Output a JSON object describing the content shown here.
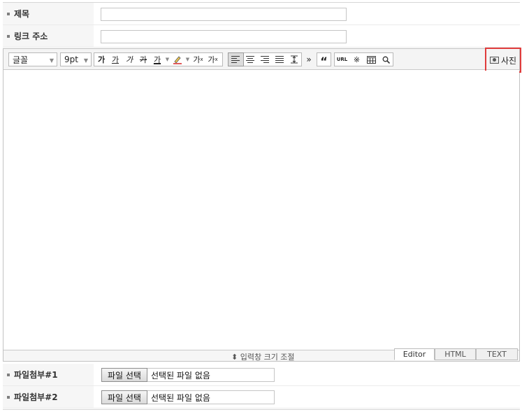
{
  "form": {
    "title_label": "제목",
    "title_value": "",
    "link_label": "링크 주소",
    "link_value": ""
  },
  "toolbar": {
    "font_family": "글꼴",
    "font_size": "9pt",
    "bold": "가",
    "underline": "가",
    "italic": "가",
    "strikethrough": "가",
    "font_color": "가",
    "superscript": "가",
    "superscript_mark": "x",
    "subscript": "가",
    "subscript_mark": "x",
    "more": "»",
    "quote": "“",
    "url": "URL",
    "special_char": "※",
    "search": "⚲",
    "photo": "사진"
  },
  "editor": {
    "resize_label": "입력창 크기 조절",
    "resize_arrow": "⬍",
    "tabs": [
      "Editor",
      "HTML",
      "TEXT"
    ],
    "active_tab": "Editor"
  },
  "attachments": [
    {
      "label": "파일첨부#1",
      "button": "파일 선택",
      "status": "선택된 파일 없음"
    },
    {
      "label": "파일첨부#2",
      "button": "파일 선택",
      "status": "선택된 파일 없음"
    }
  ]
}
